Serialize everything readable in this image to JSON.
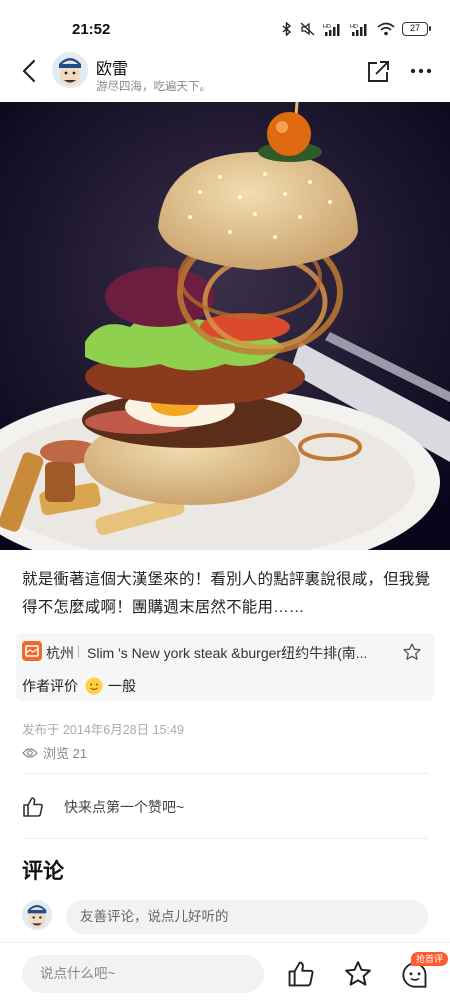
{
  "status_bar": {
    "time": "21:52",
    "battery": "27",
    "icons": [
      "bluetooth-icon",
      "mute-icon",
      "signal-hd-icon",
      "signal-hd-icon",
      "wifi-icon",
      "battery-icon"
    ]
  },
  "header": {
    "back_icon": "back-arrow-icon",
    "author_name": "欧雷",
    "author_bio": "游尽四海，吃遍天下。",
    "share_icon": "share-icon",
    "more_icon": "more-dots-icon"
  },
  "post": {
    "image_alt": "burger photo",
    "text": "就是衝著這個大漢堡來的！看別人的點評裏說很咸，但我覺得不怎麼咸啊！團購週末居然不能用……"
  },
  "poi": {
    "city": "杭州",
    "name": "Slim 's New york steak &burger纽约牛排(南...",
    "rating_label": "作者评价",
    "rating_value": "一般",
    "colors": {
      "icon": "#f06a2a",
      "emoji": "#ffd23f"
    }
  },
  "meta": {
    "publish_time": "发布于 2014年6月28日 15:49",
    "views": "浏览 21"
  },
  "likes": {
    "prompt": "快来点第一个赞吧~"
  },
  "comments": {
    "title": "评论",
    "input_placeholder": "友善评论，说点儿好听的"
  },
  "bottom_bar": {
    "input_placeholder": "说点什么吧~",
    "badge": "抢首评",
    "badge_color": "#ff5a2c"
  }
}
